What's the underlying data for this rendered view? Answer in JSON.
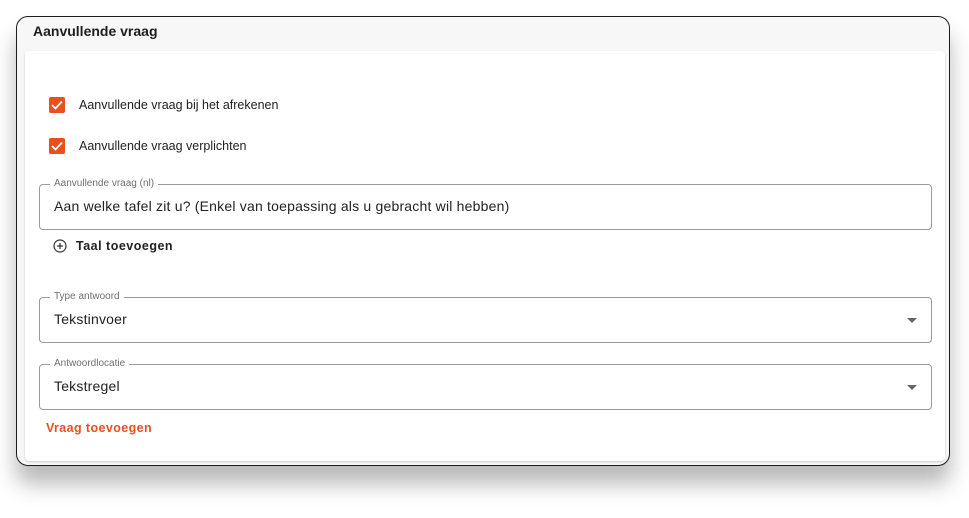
{
  "section": {
    "title": "Aanvullende vraag"
  },
  "checkboxes": [
    {
      "label": "Aanvullende vraag bij het afrekenen",
      "checked": true
    },
    {
      "label": "Aanvullende vraag verplichten",
      "checked": true
    }
  ],
  "question_field": {
    "legend": "Aanvullende vraag (nl)",
    "value": "Aan welke tafel zit u? (Enkel van toepassing als u gebracht wil hebben)"
  },
  "add_language": {
    "label": "Taal toevoegen",
    "icon": "plus-circle-icon"
  },
  "answer_type": {
    "legend": "Type antwoord",
    "value": "Tekstinvoer"
  },
  "answer_location": {
    "legend": "Antwoordlocatie",
    "value": "Tekstregel"
  },
  "add_question": {
    "label": "Vraag toevoegen"
  },
  "colors": {
    "accent": "#e8501d"
  }
}
